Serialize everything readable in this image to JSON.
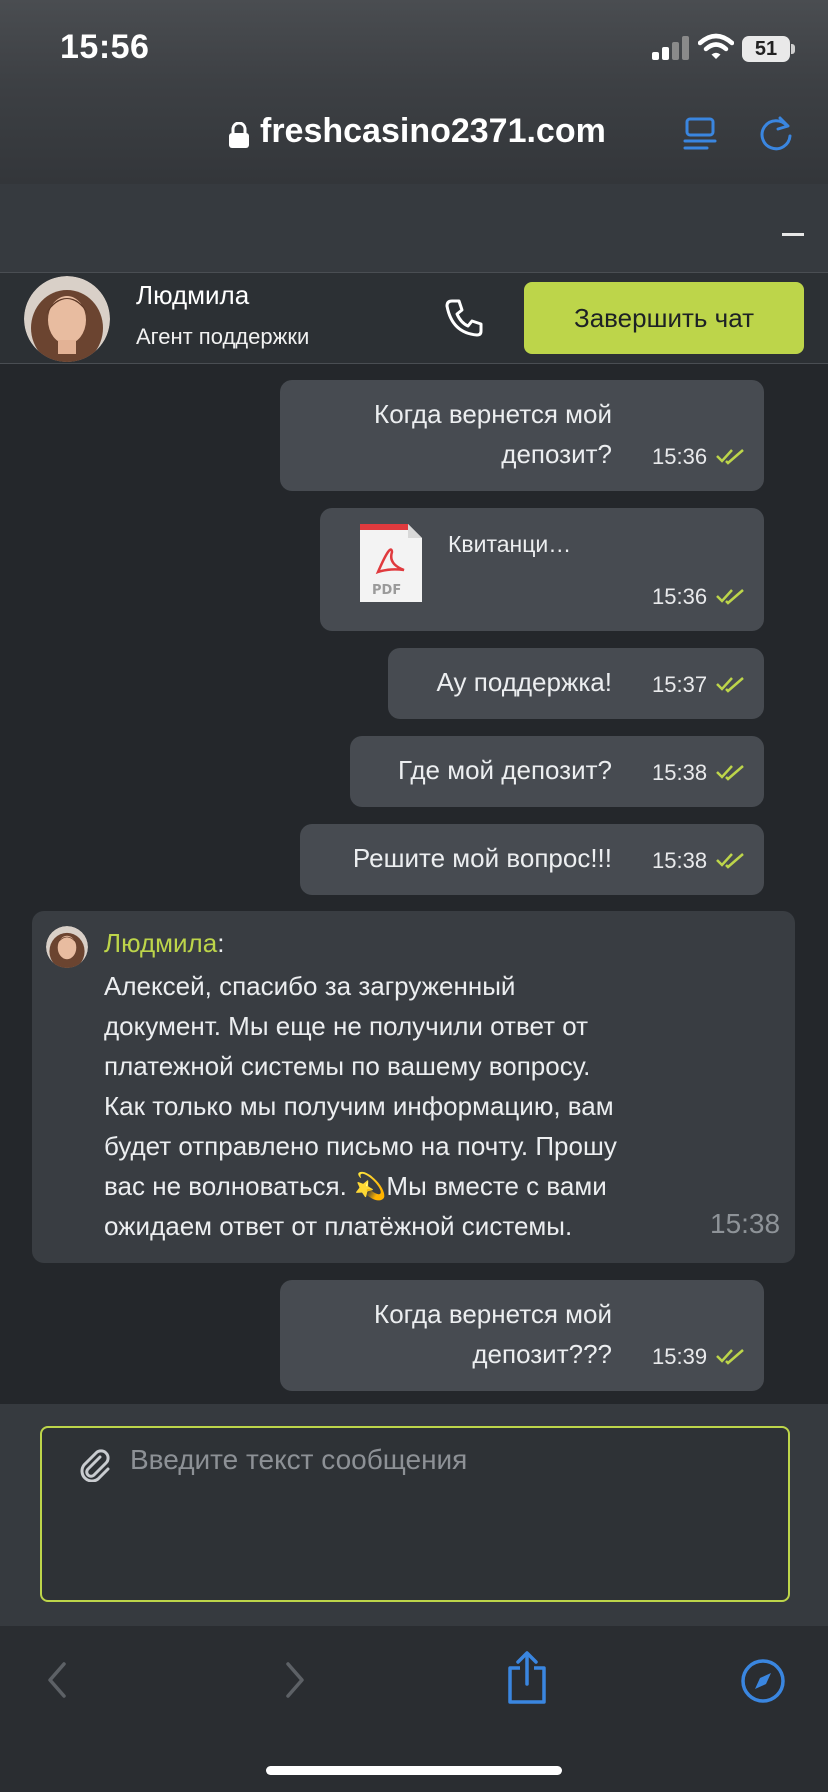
{
  "status_bar": {
    "time": "15:56",
    "battery": "51"
  },
  "browser": {
    "url": "freshcasino2371.com"
  },
  "chat_header": {
    "agent_name": "Людмила",
    "agent_role": "Агент поддержки",
    "end_chat_label": "Завершить чат"
  },
  "messages": [
    {
      "line1": "Когда вернется мой",
      "line2": "депозит?",
      "time": "15:36"
    },
    {
      "file_name": "Квитанци…",
      "file_badge": "PDF",
      "time": "15:36"
    },
    {
      "text": "Ау поддержка!",
      "time": "15:37"
    },
    {
      "text": "Где мой депозит?",
      "time": "15:38"
    },
    {
      "text": "Решите мой вопрос!!!",
      "time": "15:38"
    },
    {
      "line1": "Когда вернется мой",
      "line2": "депозит???",
      "time": "15:39"
    }
  ],
  "agent_message": {
    "name": "Людмила",
    "colon": ":",
    "lines": [
      "Алексей, спасибо за загруженный",
      "документ. Мы еще не получили ответ от",
      "платежной системы по вашему вопросу.",
      "Как только мы получим информацию, вам",
      "будет отправлено письмо на почту. Прошу",
      "вас не волноваться. 💫Мы вместе с вами",
      "ожидаем ответ от платёжной системы."
    ],
    "time": "15:38"
  },
  "input": {
    "placeholder": "Введите текст сообщения"
  },
  "colors": {
    "accent": "#bdd54a",
    "bubble": "#474b51",
    "agent_bubble": "#393d42",
    "background": "#24272b",
    "ios_blue": "#3a86e0"
  }
}
